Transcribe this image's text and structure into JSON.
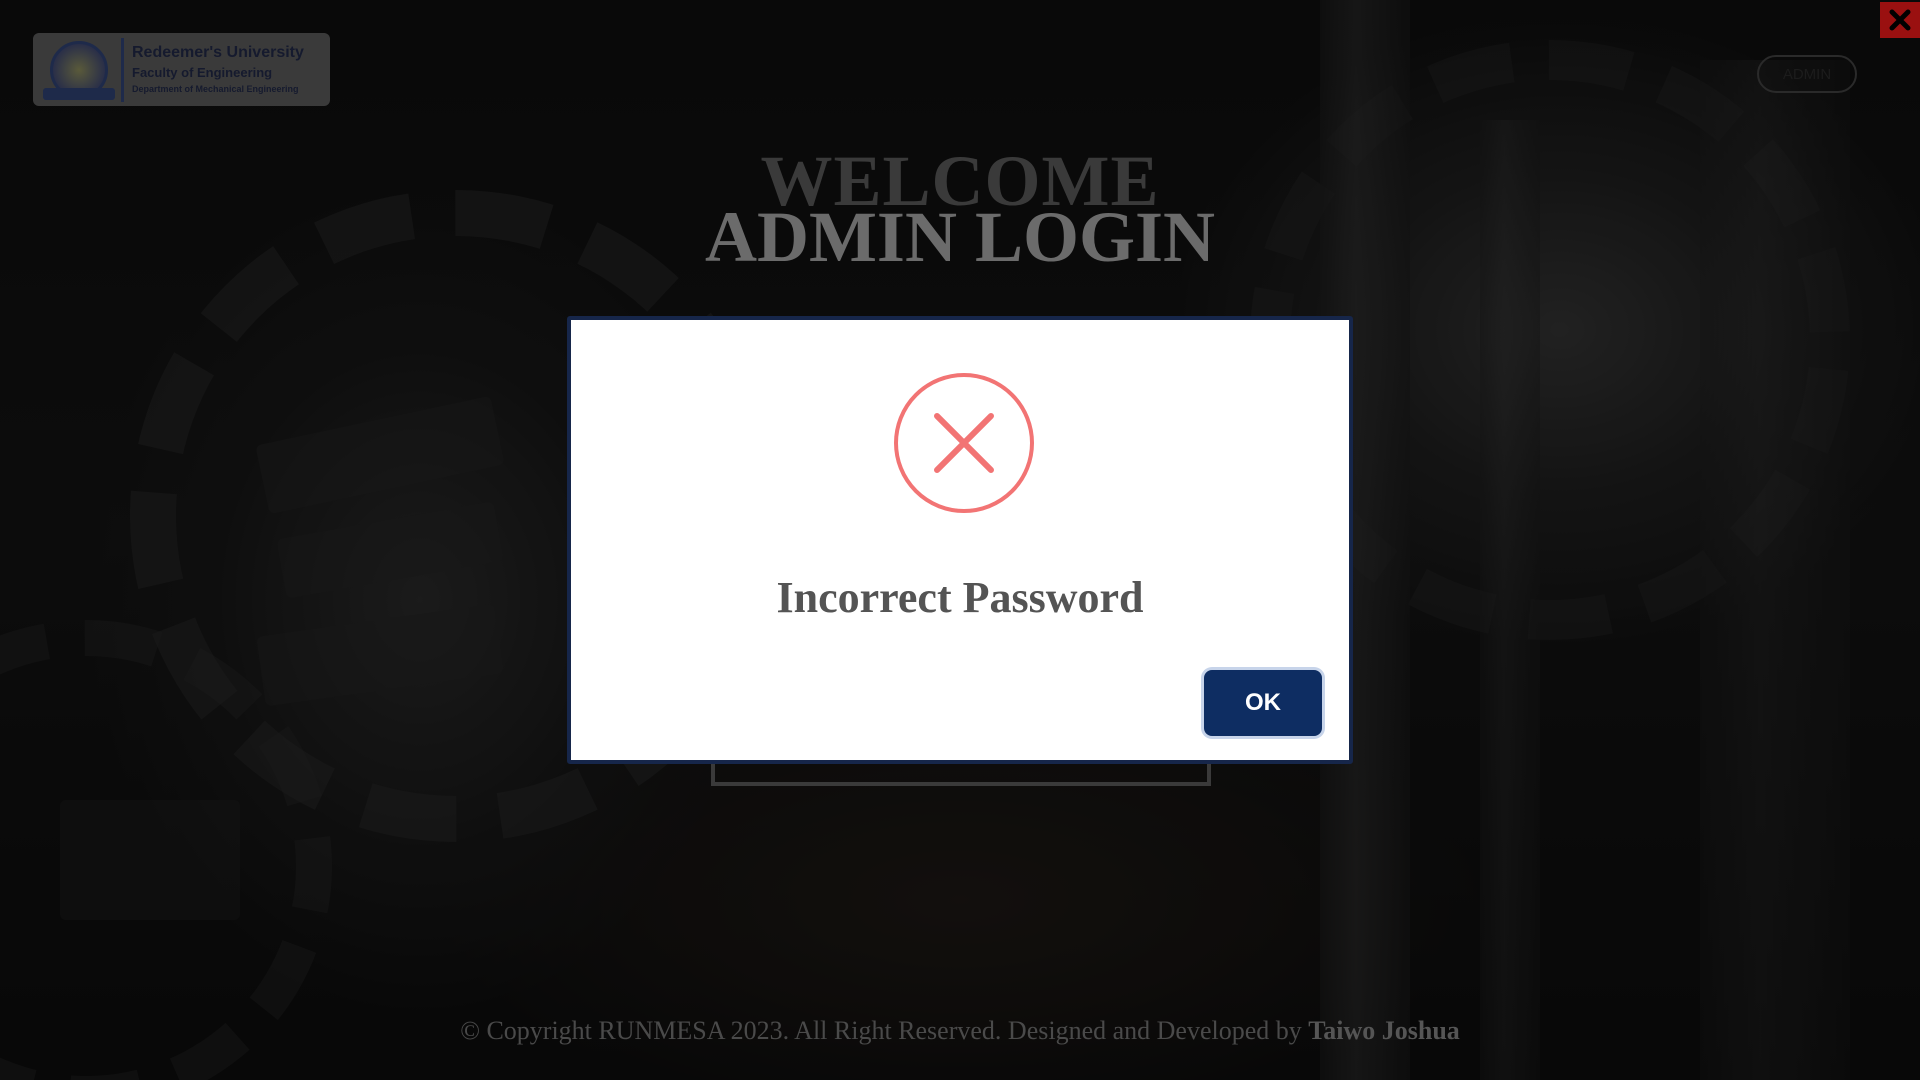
{
  "header": {
    "logo": {
      "line1": "Redeemer's University",
      "line2": "Faculty of Engineering",
      "line3": "Department of Mechanical Engineering"
    },
    "admin_label": "ADMIN"
  },
  "hero": {
    "welcome": "WELCOME",
    "title": "ADMIN LOGIN"
  },
  "modal": {
    "icon": "error-x-icon",
    "message": "Incorrect Password",
    "ok_label": "OK"
  },
  "footer": {
    "text": "© Copyright RUNMESA 2023. All Right Reserved. Designed and Developed by ",
    "author": "Taiwo Joshua"
  },
  "colors": {
    "modal_border": "#16264a",
    "ok_button": "#0e2d62",
    "error_icon": "#f27474",
    "close_button": "#9a1010"
  }
}
